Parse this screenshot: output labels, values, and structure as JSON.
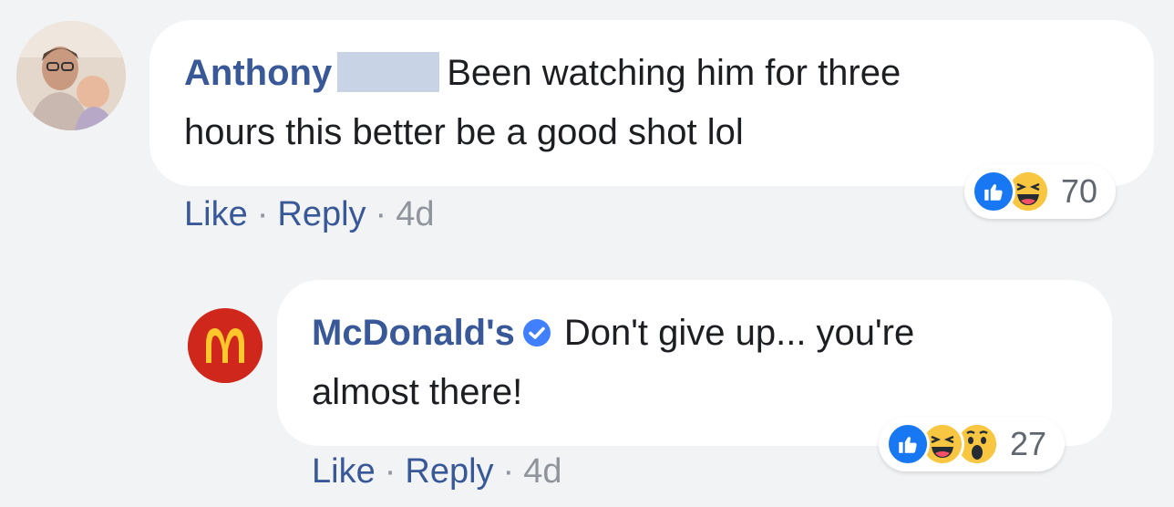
{
  "comments": [
    {
      "author": "Anthony",
      "text_line1": "Been watching him for three",
      "text_line2": "hours this better be a good shot lol",
      "actions": {
        "like": "Like",
        "reply": "Reply",
        "time": "4d",
        "sep": "·"
      },
      "reactions": {
        "icons": [
          "like-icon",
          "haha-icon"
        ],
        "count": "70"
      }
    },
    {
      "author": "McDonald's",
      "verified": true,
      "text_line1": "Don't give up... you're",
      "text_line2": "almost there!",
      "actions": {
        "like": "Like",
        "reply": "Reply",
        "time": "4d",
        "sep": "·"
      },
      "reactions": {
        "icons": [
          "like-icon",
          "haha-icon",
          "wow-icon"
        ],
        "count": "27"
      }
    }
  ],
  "colors": {
    "author_link": "#385898",
    "bubble": "#ffffff",
    "background": "#f2f3f5",
    "like_blue": "#1877f2",
    "mcd_red": "#d0271c",
    "mcd_gold": "#ffc72c"
  }
}
